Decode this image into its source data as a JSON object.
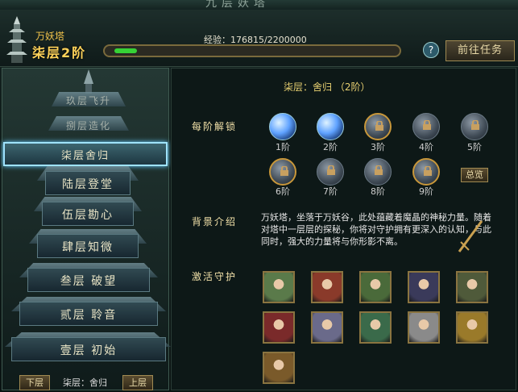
{
  "window": {
    "title": "九层妖塔"
  },
  "header": {
    "tower_name": "万妖塔",
    "current_floor": "柒层2阶",
    "exp_label": "经验：176815/2200000",
    "exp_progress": 0.08,
    "help_label": "?",
    "goto_task_label": "前往任务"
  },
  "tower": {
    "floors": [
      {
        "label": "玖层飞升",
        "state": "locked"
      },
      {
        "label": "捌层造化",
        "state": "locked"
      },
      {
        "label": "柒层舍归",
        "state": "selected"
      },
      {
        "label": "陆层登堂",
        "state": "open"
      },
      {
        "label": "伍层勘心",
        "state": "open"
      },
      {
        "label": "肆层知微",
        "state": "open"
      },
      {
        "label": "叁层 破望",
        "state": "open"
      },
      {
        "label": "贰层 聆音",
        "state": "open"
      },
      {
        "label": "壹层 初始",
        "state": "open"
      }
    ],
    "prev_button": "下层",
    "next_button": "上层",
    "current_label": "柒层：舍归"
  },
  "detail": {
    "title": "柒层：舍归  （2阶）",
    "unlock_label": "每阶解锁",
    "tiers": [
      {
        "label": "1阶",
        "state": "open"
      },
      {
        "label": "2阶",
        "state": "open"
      },
      {
        "label": "3阶",
        "state": "locked-gold"
      },
      {
        "label": "4阶",
        "state": "locked"
      },
      {
        "label": "5阶",
        "state": "locked"
      },
      {
        "label": "6阶",
        "state": "locked-gold"
      },
      {
        "label": "7阶",
        "state": "locked"
      },
      {
        "label": "8阶",
        "state": "locked"
      },
      {
        "label": "9阶",
        "state": "locked-gold"
      }
    ],
    "preview_label": "总览",
    "background_label": "背景介绍",
    "background_text": "万妖塔，坐落于万妖谷，此处蕴藏着魔晶的神秘力量。随着对塔中一层层的探秘，你将对守护拥有更深入的认知，与此同时，强大的力量将与你形影不离。",
    "guardians_label": "激活守护",
    "guardians": [
      {
        "name": "dragon-warrior",
        "color": "#5a7a4a"
      },
      {
        "name": "red-maiden",
        "color": "#8a3a2a"
      },
      {
        "name": "green-lady",
        "color": "#4a6a3a"
      },
      {
        "name": "dark-witch",
        "color": "#3a3a5a"
      },
      {
        "name": "green-general",
        "color": "#4f5a3a"
      },
      {
        "name": "crimson-lady",
        "color": "#7a2a2a"
      },
      {
        "name": "white-demon",
        "color": "#6a6a8a"
      },
      {
        "name": "jade-swordsman",
        "color": "#3a6a4a"
      },
      {
        "name": "silver-elder",
        "color": "#8a8a8a"
      },
      {
        "name": "golden-knight",
        "color": "#9a7a2a"
      },
      {
        "name": "beast-king",
        "color": "#7a5a2a"
      }
    ]
  }
}
